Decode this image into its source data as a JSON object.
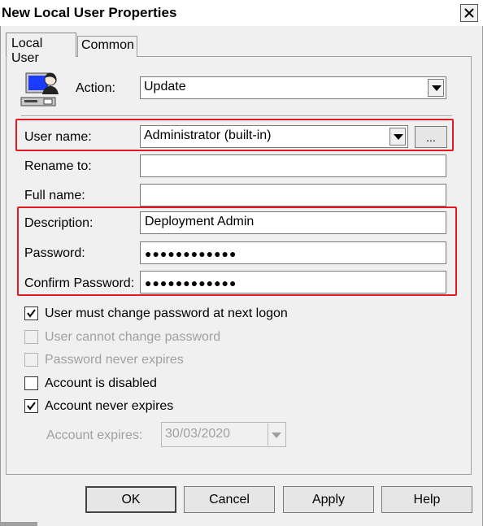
{
  "window": {
    "title": "New Local User Properties"
  },
  "tabs": [
    "Local User",
    "Common"
  ],
  "action": {
    "label": "Action:",
    "value": "Update"
  },
  "user_name": {
    "label": "User name:",
    "value": "Administrator (built-in)",
    "browse_label": "..."
  },
  "rename_to": {
    "label": "Rename to:",
    "value": ""
  },
  "full_name": {
    "label": "Full name:",
    "value": ""
  },
  "description": {
    "label": "Description:",
    "value": "Deployment Admin"
  },
  "password": {
    "label": "Password:",
    "value": "●●●●●●●●●●●●"
  },
  "confirm_password": {
    "label": "Confirm Password:",
    "value": "●●●●●●●●●●●●"
  },
  "checkboxes": [
    {
      "label": "User must change password at next logon",
      "checked": true,
      "enabled": true
    },
    {
      "label": "User cannot change password",
      "checked": false,
      "enabled": false
    },
    {
      "label": "Password never expires",
      "checked": false,
      "enabled": false
    },
    {
      "label": "Account is disabled",
      "checked": false,
      "enabled": true
    },
    {
      "label": "Account never expires",
      "checked": true,
      "enabled": true
    }
  ],
  "account_expires": {
    "label": "Account expires:",
    "value": "30/03/2020"
  },
  "buttons": {
    "ok": "OK",
    "cancel": "Cancel",
    "apply": "Apply",
    "help": "Help"
  },
  "highlight_color": "#e01b24",
  "icons": {
    "close": "close-icon",
    "user": "user-computer-icon",
    "dropdown": "chevron-down-icon",
    "check": "check-icon"
  }
}
